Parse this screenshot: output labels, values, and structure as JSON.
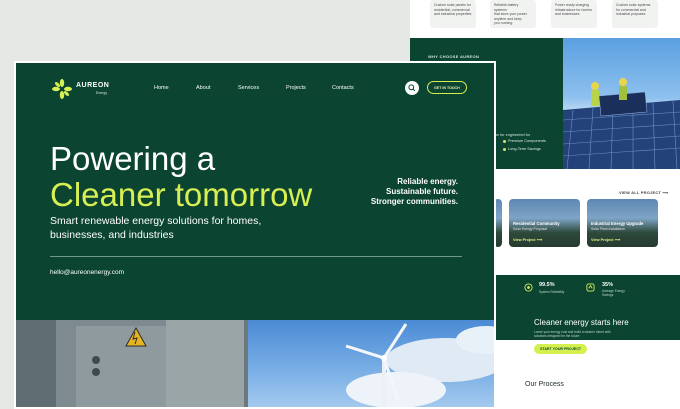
{
  "background_page": {
    "features": [
      {
        "lines": [
          "Custom solar panels for",
          "residential, commercial",
          "and industrial properties"
        ]
      },
      {
        "lines": [
          "Reliable battery systems",
          "that store your power",
          "anytime and keep",
          "you running"
        ]
      },
      {
        "lines": [
          "Power ready charging",
          "infrastructure for homes",
          "and businesses"
        ]
      },
      {
        "lines": [
          "Custom solar systems",
          "for commercial and",
          "industrial purposes"
        ]
      }
    ],
    "why_tag": "WHY CHOOSE AUREON",
    "why_snippet": "ion for engineered for",
    "why_items": [
      "Premium Components",
      "Long-Term Savings"
    ],
    "projects_link": "VIEW ALL PROJECT",
    "projects": [
      {
        "title": "Residential Community",
        "sub": "Solar Energy Proposal",
        "view": "View Project"
      },
      {
        "title": "Industrial Energy Upgrade",
        "sub": "Solar Plant Installation",
        "view": "View Project"
      }
    ],
    "stats": [
      {
        "value": "99.5%",
        "label": [
          "System",
          "Reliability"
        ]
      },
      {
        "value": "35%",
        "label": [
          "Average Energy",
          "Savings"
        ]
      }
    ],
    "cta": {
      "heading": "Cleaner energy starts here",
      "sub": "Lower your energy cost and build a cleaner future with solutions designed for the future",
      "button": "START YOUR PROJECT"
    },
    "process_heading": "Our Process"
  },
  "hero": {
    "brand": "AUREON",
    "brand_sub": "Energy",
    "nav": [
      "Home",
      "About",
      "Services",
      "Projects",
      "Contacts"
    ],
    "touch_button": "GET IN TOUCH",
    "headline_1": "Powering a",
    "headline_2": "Cleaner tomorrow",
    "sub_1": "Smart renewable energy solutions for homes,",
    "sub_2": "businesses, and industries",
    "taglines": [
      "Reliable energy.",
      "Sustainable future.",
      "Stronger communities."
    ],
    "email": "hello@aureonenergy.com"
  },
  "colors": {
    "brand_green": "#0b4431",
    "accent_lime": "#d7ef52"
  }
}
